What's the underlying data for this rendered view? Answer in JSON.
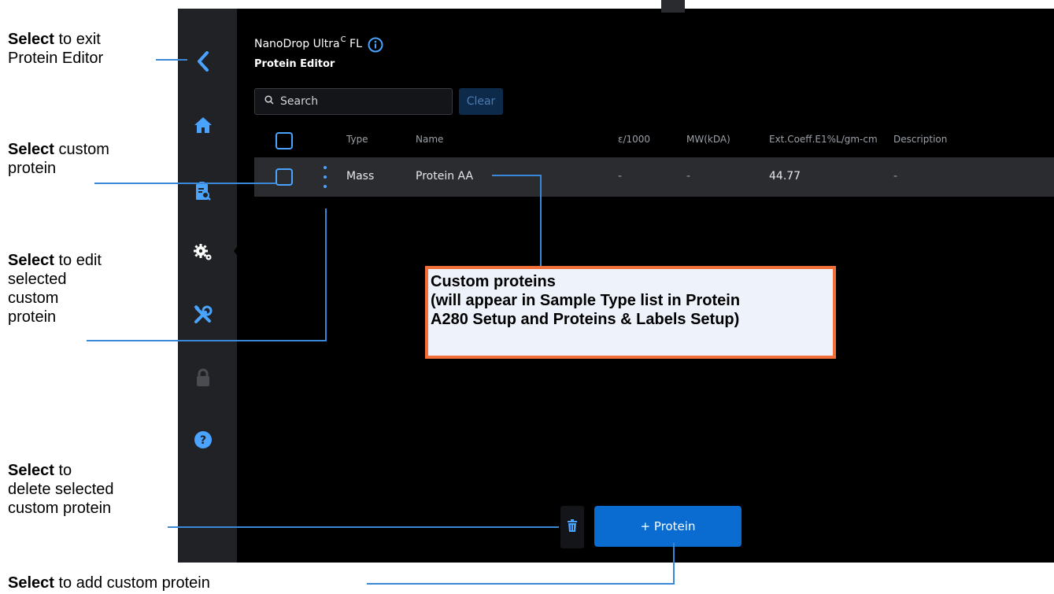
{
  "device": {
    "app_title": "NanoDrop Ultra",
    "app_title_sup": "C",
    "app_title_suffix": "FL",
    "page_title": "Protein Editor",
    "search": {
      "placeholder": "Search"
    },
    "clear_label": "Clear",
    "sidebar": [
      {
        "icon": "chevron-left-icon"
      },
      {
        "icon": "home-icon"
      },
      {
        "icon": "clipboard-search-icon"
      },
      {
        "icon": "gears-icon",
        "active": true
      },
      {
        "icon": "tools-icon"
      },
      {
        "icon": "lock-icon"
      },
      {
        "icon": "help-icon"
      }
    ],
    "table": {
      "columns": [
        "Type",
        "Name",
        "ε/1000",
        "MW(kDA)",
        "Ext.Coeff.E1%L/gm-cm",
        "Description"
      ],
      "rows": [
        {
          "type": "Mass",
          "name": "Protein AA",
          "e1000": "-",
          "mw": "-",
          "ext_coeff": "44.77",
          "description": "-"
        }
      ]
    },
    "add_protein_label": "+ Protein"
  },
  "annotations": {
    "exit": {
      "bold": "Select",
      "line1_rest": " to exit",
      "line2": "Protein Editor"
    },
    "select_custom": {
      "bold": "Select",
      "line1_rest": " custom",
      "line2": "protein"
    },
    "edit": {
      "bold": "Select",
      "line1_rest": " to edit",
      "line2": "selected",
      "line3": "custom",
      "line4": "protein"
    },
    "delete": {
      "bold": "Select",
      "line1_rest": " to",
      "line2": "delete selected",
      "line3": "custom protein"
    },
    "add": {
      "bold": "Select",
      "line1_rest": " to add custom protein"
    },
    "custom_box": {
      "line1": "Custom proteins",
      "line2": "(will appear in Sample Type list in Protein",
      "line3": "A280 Setup and Proteins & Labels Setup)"
    }
  },
  "colors": {
    "accent": "#4aa3ff",
    "primary_button": "#0a6bd1",
    "callout_border": "#f26f3a",
    "callout_fill": "#eef3fb",
    "leader_line": "#3b88d9"
  }
}
